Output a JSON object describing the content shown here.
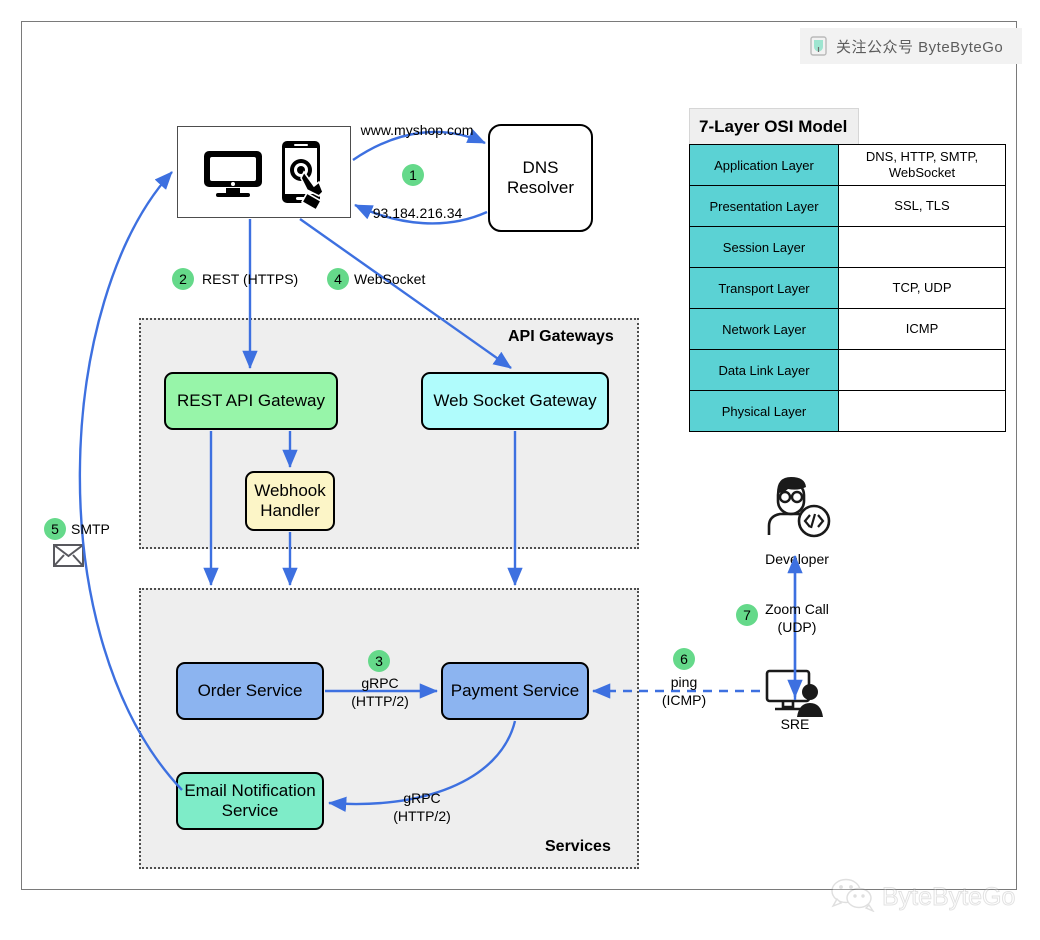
{
  "watermark": {
    "icon": "wechat-badge-icon",
    "text": "关注公众号 ByteByteGo"
  },
  "footer_logo": {
    "icon": "wechat-icon",
    "text": "ByteByteGo"
  },
  "osi_table": {
    "title": "7-Layer OSI Model",
    "rows": [
      {
        "layer": "Application Layer",
        "protocols": "DNS, HTTP, SMTP,\nWebSocket"
      },
      {
        "layer": "Presentation Layer",
        "protocols": "SSL, TLS"
      },
      {
        "layer": "Session Layer",
        "protocols": ""
      },
      {
        "layer": "Transport Layer",
        "protocols": "TCP, UDP"
      },
      {
        "layer": "Network Layer",
        "protocols": "ICMP"
      },
      {
        "layer": "Data Link Layer",
        "protocols": ""
      },
      {
        "layer": "Physical Layer",
        "protocols": ""
      }
    ]
  },
  "nodes": {
    "client_devices": {
      "desktop_icon": "desktop-monitor-icon",
      "mobile_icon": "mobile-phone-tap-icon"
    },
    "dns_resolver": "DNS\nResolver",
    "rest_api_gateway": "REST API Gateway",
    "web_socket_gateway": "Web Socket Gateway",
    "webhook_handler": "Webhook\nHandler",
    "order_service": "Order Service",
    "payment_service": "Payment Service",
    "email_notification_service": "Email Notification\nService",
    "developer": "Developer",
    "sre": "SRE"
  },
  "groups": {
    "api_gateways": "API Gateways",
    "services": "Services"
  },
  "edge_labels": {
    "dns_query": "www.myshop.com",
    "dns_answer": "93.184.216.34",
    "rest": "REST (HTTPS)",
    "websocket": "WebSocket",
    "grpc_order_payment": "gRPC\n(HTTP/2)",
    "grpc_payment_email": "gRPC\n(HTTP/2)",
    "smtp": "SMTP",
    "ping": "ping\n(ICMP)",
    "zoom_call": "Zoom Call\n(UDP)"
  },
  "steps": {
    "s1": "1",
    "s2": "2",
    "s3": "3",
    "s4": "4",
    "s5": "5",
    "s6": "6",
    "s7": "7"
  },
  "colors": {
    "badge_green": "#65d98a",
    "gateway_green": "#97f5a9",
    "gateway_cyan": "#b0fcfc",
    "webhook_yellow": "#fcf5c7",
    "service_blue": "#8cb4f0",
    "email_teal": "#7eecc8",
    "osi_turquoise": "#5bd2d4",
    "arrow_blue": "#3d70e0",
    "group_bg": "#eeeeee"
  }
}
